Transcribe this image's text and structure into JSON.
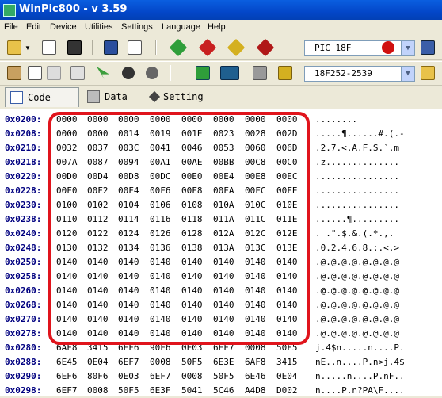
{
  "window": {
    "title": "WinPic800   -  v 3.59"
  },
  "menu": [
    "File",
    "Edit",
    "Device",
    "Utilities",
    "Settings",
    "Language",
    "Help"
  ],
  "device_family": {
    "value": "PIC 18F"
  },
  "device_model": {
    "value": "18F252-2539"
  },
  "tabs": [
    {
      "label": "Code"
    },
    {
      "label": "Data"
    },
    {
      "label": "Setting"
    }
  ],
  "icons": {
    "open": "folder-open-icon",
    "reload": "reload-icon",
    "save": "save-icon",
    "hex_view": "hex-view-icon",
    "edit_doc": "document-edit-icon",
    "read": "read-chip-icon",
    "write": "write-chip-icon",
    "verify": "verify-icon",
    "erase": "erase-icon",
    "micro": "microchip-logo-icon",
    "help": "help-book-icon",
    "paste": "paste-icon",
    "copy": "copy-icon",
    "cut": "cut-icon",
    "fill": "fill-icon",
    "select": "select-icon",
    "find": "find-icon",
    "find2": "find-next-icon",
    "dev": "device-detect-icon",
    "hardware": "hardware-icon",
    "cable": "cable-icon",
    "config": "config-icon",
    "device_list": "device-list-icon"
  },
  "rows": [
    {
      "addr": "0x0200:",
      "words": [
        "0000",
        "0000",
        "0000",
        "0000",
        "0000",
        "0000",
        "0000",
        "0000"
      ],
      "ascii": "........"
    },
    {
      "addr": "0x0208:",
      "words": [
        "0000",
        "0000",
        "0014",
        "0019",
        "001E",
        "0023",
        "0028",
        "002D"
      ],
      "ascii": ".....¶......#.(.-"
    },
    {
      "addr": "0x0210:",
      "words": [
        "0032",
        "0037",
        "003C",
        "0041",
        "0046",
        "0053",
        "0060",
        "006D"
      ],
      "ascii": ".2.7.<.A.F.S.`.m"
    },
    {
      "addr": "0x0218:",
      "words": [
        "007A",
        "0087",
        "0094",
        "00A1",
        "00AE",
        "00BB",
        "00C8",
        "00C0"
      ],
      "ascii": ".z.............."
    },
    {
      "addr": "0x0220:",
      "words": [
        "00D0",
        "00D4",
        "00D8",
        "00DC",
        "00E0",
        "00E4",
        "00E8",
        "00EC"
      ],
      "ascii": "................"
    },
    {
      "addr": "0x0228:",
      "words": [
        "00F0",
        "00F2",
        "00F4",
        "00F6",
        "00F8",
        "00FA",
        "00FC",
        "00FE"
      ],
      "ascii": "................"
    },
    {
      "addr": "0x0230:",
      "words": [
        "0100",
        "0102",
        "0104",
        "0106",
        "0108",
        "010A",
        "010C",
        "010E"
      ],
      "ascii": "................"
    },
    {
      "addr": "0x0238:",
      "words": [
        "0110",
        "0112",
        "0114",
        "0116",
        "0118",
        "011A",
        "011C",
        "011E"
      ],
      "ascii": "......¶........."
    },
    {
      "addr": "0x0240:",
      "words": [
        "0120",
        "0122",
        "0124",
        "0126",
        "0128",
        "012A",
        "012C",
        "012E"
      ],
      "ascii": ". .\".$.&.(.*.,."
    },
    {
      "addr": "0x0248:",
      "words": [
        "0130",
        "0132",
        "0134",
        "0136",
        "0138",
        "013A",
        "013C",
        "013E"
      ],
      "ascii": ".0.2.4.6.8.:.<.>"
    },
    {
      "addr": "0x0250:",
      "words": [
        "0140",
        "0140",
        "0140",
        "0140",
        "0140",
        "0140",
        "0140",
        "0140"
      ],
      "ascii": ".@.@.@.@.@.@.@.@"
    },
    {
      "addr": "0x0258:",
      "words": [
        "0140",
        "0140",
        "0140",
        "0140",
        "0140",
        "0140",
        "0140",
        "0140"
      ],
      "ascii": ".@.@.@.@.@.@.@.@"
    },
    {
      "addr": "0x0260:",
      "words": [
        "0140",
        "0140",
        "0140",
        "0140",
        "0140",
        "0140",
        "0140",
        "0140"
      ],
      "ascii": ".@.@.@.@.@.@.@.@"
    },
    {
      "addr": "0x0268:",
      "words": [
        "0140",
        "0140",
        "0140",
        "0140",
        "0140",
        "0140",
        "0140",
        "0140"
      ],
      "ascii": ".@.@.@.@.@.@.@.@"
    },
    {
      "addr": "0x0270:",
      "words": [
        "0140",
        "0140",
        "0140",
        "0140",
        "0140",
        "0140",
        "0140",
        "0140"
      ],
      "ascii": ".@.@.@.@.@.@.@.@"
    },
    {
      "addr": "0x0278:",
      "words": [
        "0140",
        "0140",
        "0140",
        "0140",
        "0140",
        "0140",
        "0140",
        "0140"
      ],
      "ascii": ".@.@.@.@.@.@.@.@"
    },
    {
      "addr": "0x0280:",
      "words": [
        "6AF8",
        "3415",
        "6EF6",
        "90F6",
        "0E03",
        "6EF7",
        "0008",
        "50F5"
      ],
      "ascii": "j.4$n.....n....P."
    },
    {
      "addr": "0x0288:",
      "words": [
        "6E45",
        "0E04",
        "6EF7",
        "0008",
        "50F5",
        "6E3E",
        "6AF8",
        "3415"
      ],
      "ascii": "nE..n....P.n>j.4$"
    },
    {
      "addr": "0x0290:",
      "words": [
        "6EF6",
        "80F6",
        "0E03",
        "6EF7",
        "0008",
        "50F5",
        "6E46",
        "0E04"
      ],
      "ascii": "n.....n....P.nF.."
    },
    {
      "addr": "0x0298:",
      "words": [
        "6EF7",
        "0008",
        "50F5",
        "6E3F",
        "5041",
        "5C46",
        "A4D8",
        "D002"
      ],
      "ascii": "n....P.n?PA\\F...."
    }
  ]
}
